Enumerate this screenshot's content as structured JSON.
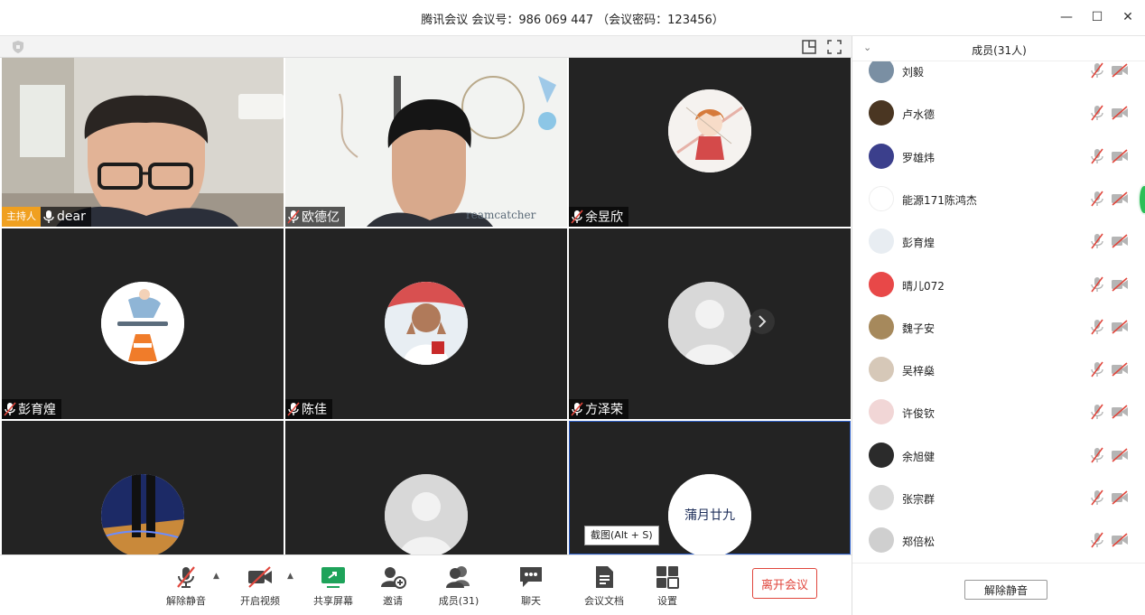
{
  "window": {
    "title": "腾讯会议 会议号：986 069 447 （会议密码：123456）",
    "controls": [
      "—",
      "☐",
      "✕"
    ]
  },
  "tiles": [
    {
      "name": "dear",
      "host_label": "主持人",
      "type": "camera",
      "mic": "on"
    },
    {
      "name": "欧德亿",
      "type": "camera",
      "mic": "off"
    },
    {
      "name": "余昱欣",
      "type": "avatar",
      "avatar": "anime-girl",
      "mic": "off"
    },
    {
      "name": "彭育煌",
      "type": "avatar",
      "avatar": "skater-cone",
      "mic": "off"
    },
    {
      "name": "陈佳",
      "type": "avatar",
      "avatar": "football-player",
      "mic": "off"
    },
    {
      "name": "方泽荣",
      "type": "avatar",
      "avatar": "default-person",
      "mic": "off"
    },
    {
      "name": "",
      "type": "avatar",
      "avatar": "basketball-court"
    },
    {
      "name": "",
      "type": "avatar",
      "avatar": "default-person"
    },
    {
      "name": "",
      "type": "avatar",
      "avatar": "calligraphy",
      "avatar_text": "蒲月廿九",
      "active": true
    }
  ],
  "tooltip": "截图(Alt + S)",
  "toolbar": {
    "unmute": "解除静音",
    "start_video": "开启视频",
    "share_screen": "共享屏幕",
    "invite": "邀请",
    "members": "成员(31)",
    "chat": "聊天",
    "docs": "会议文档",
    "settings": "设置",
    "leave": "离开会议"
  },
  "side_panel": {
    "title": "成员(31人)",
    "unmute_all": "解除静音",
    "members": [
      {
        "name": "刘毅",
        "color": "#7a8fa3"
      },
      {
        "name": "卢水德",
        "color": "#4a3622"
      },
      {
        "name": "罗雄炜",
        "color": "#3b3f8c"
      },
      {
        "name": "能源171陈鸿杰",
        "color": "#ffffff"
      },
      {
        "name": "彭育煌",
        "color": "#e8edf2"
      },
      {
        "name": "晴儿072",
        "color": "#e84848"
      },
      {
        "name": "魏子安",
        "color": "#a6895c"
      },
      {
        "name": "吴梓燊",
        "color": "#d6c8b8"
      },
      {
        "name": "许俊钦",
        "color": "#f1d6d6"
      },
      {
        "name": "余旭健",
        "color": "#2b2b2b"
      },
      {
        "name": "张宗群",
        "color": "#d9d9d9"
      },
      {
        "name": "郑倍松",
        "color": "#cfcfcf"
      }
    ]
  }
}
